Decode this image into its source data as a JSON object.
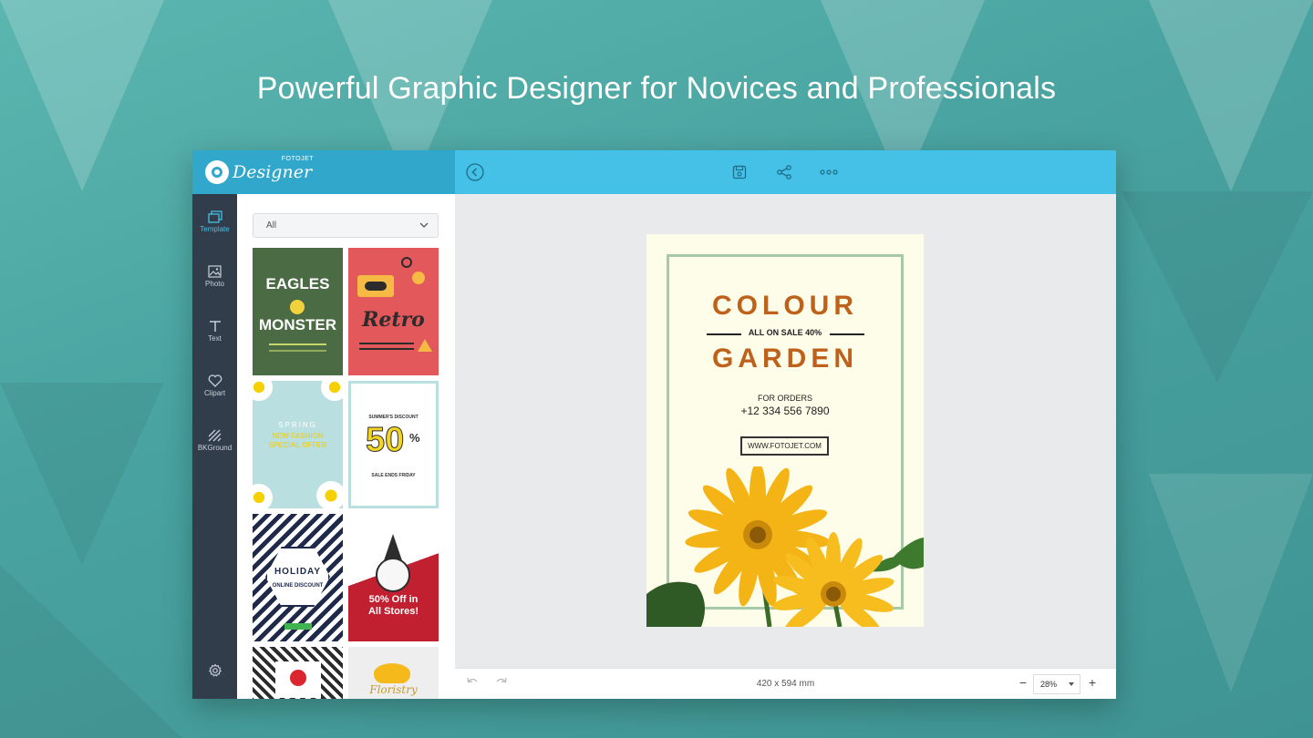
{
  "headline": "Powerful Graphic Designer for Novices and Professionals",
  "app": {
    "brand": {
      "name": "Designer",
      "sub": "FOTOJET"
    },
    "topbar": {
      "icons": [
        "back-icon",
        "save-icon",
        "share-icon",
        "more-icon"
      ]
    },
    "nav": [
      {
        "label": "Template",
        "icon": "template-icon",
        "active": true
      },
      {
        "label": "Photo",
        "icon": "photo-icon"
      },
      {
        "label": "Text",
        "icon": "text-icon"
      },
      {
        "label": "Clipart",
        "icon": "heart-icon"
      },
      {
        "label": "BKGround",
        "icon": "background-icon"
      }
    ],
    "settings_icon": "gear-icon",
    "filter": {
      "value": "All"
    },
    "templates": [
      {
        "name": "eagles-monster",
        "lines": [
          "EAGLES",
          "MONSTER"
        ],
        "bg": "#4b6b45"
      },
      {
        "name": "retro",
        "lines": [
          "Retro"
        ],
        "bg": "#e3585a"
      },
      {
        "name": "spring-fashion",
        "lines": [
          "SPRING",
          "NEW FASHION",
          "SPECIAL OFFER"
        ],
        "bg": "#b9dfe0"
      },
      {
        "name": "summer-discount",
        "lines": [
          "SUMMER'S DISCOUNT",
          "50",
          "%",
          "SALE ENDS FRIDAY"
        ],
        "bg": "#ffffff"
      },
      {
        "name": "holiday",
        "lines": [
          "HOLIDAY",
          "ONLINE DISCOUNT"
        ],
        "bg": "#1f2a4a"
      },
      {
        "name": "christmas-discount",
        "lines": [
          "50% Off in",
          "All Stores!"
        ],
        "bg": "#c0202f"
      },
      {
        "name": "chevron-template",
        "lines": [],
        "bg": "#ffffff"
      },
      {
        "name": "floristry",
        "lines": [
          "Floristry"
        ],
        "bg": "#eeeeee"
      }
    ],
    "canvas": {
      "poster": {
        "title1": "COLOUR",
        "sale": "ALL ON SALE 40%",
        "title2": "GARDEN",
        "orders": "FOR ORDERS",
        "phone": "+12 334 556 7890",
        "website": "WWW.FOTOJET.COM"
      }
    },
    "bottombar": {
      "size": "420 x 594 mm",
      "zoom": "28%"
    },
    "colors": {
      "header_dark": "#32a7cc",
      "header_light": "#45c0e6",
      "nav_bg": "#323d4b",
      "poster_title": "#c0611b"
    }
  }
}
